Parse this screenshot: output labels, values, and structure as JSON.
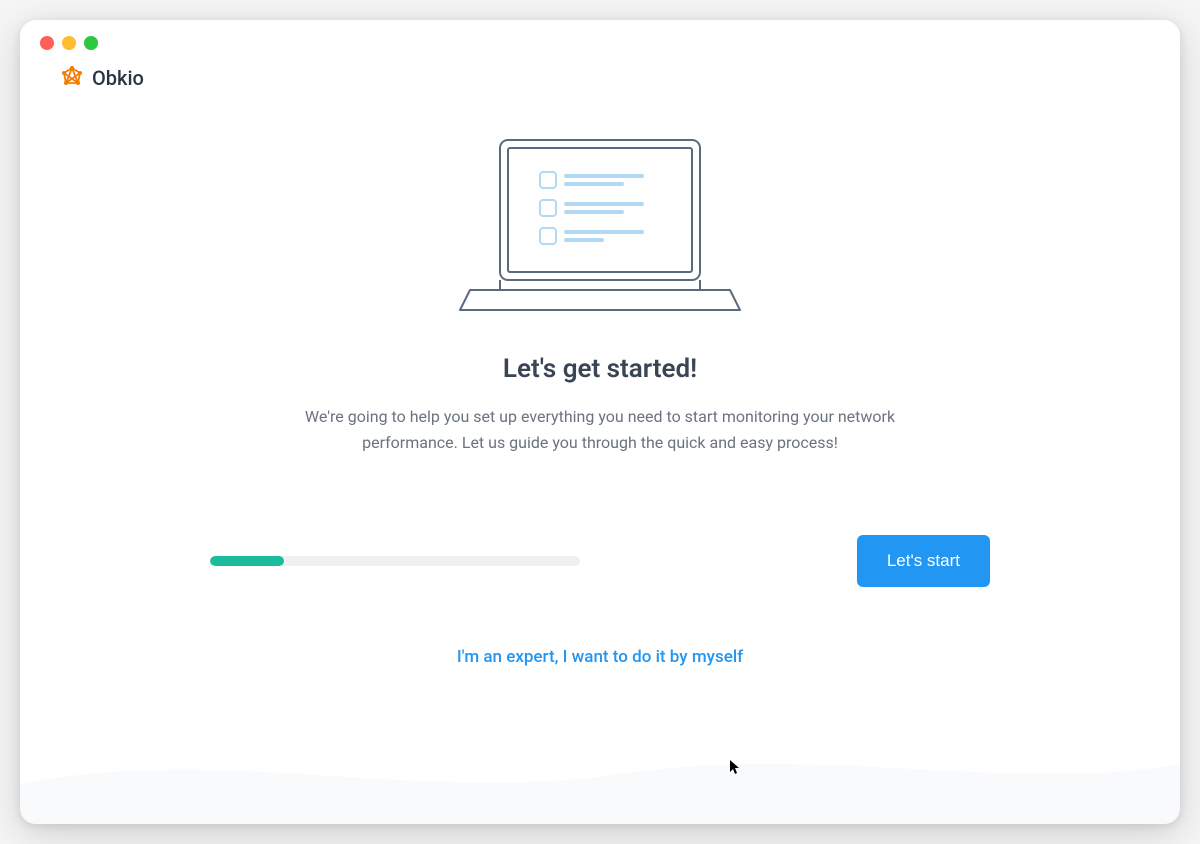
{
  "brand": {
    "name": "Obkio",
    "logo_color": "#f57c00"
  },
  "onboarding": {
    "heading": "Let's get started!",
    "description": "We're going to help you set up everything you need to start monitoring your network performance. Let us guide you through the quick and easy process!",
    "primary_button": "Let's start",
    "skip_link": "I'm an expert, I want to do it by myself",
    "progress_percent": 20
  },
  "colors": {
    "primary": "#2196f3",
    "progress": "#1abc9c",
    "text_heading": "#3a4455",
    "text_body": "#6b7280"
  }
}
